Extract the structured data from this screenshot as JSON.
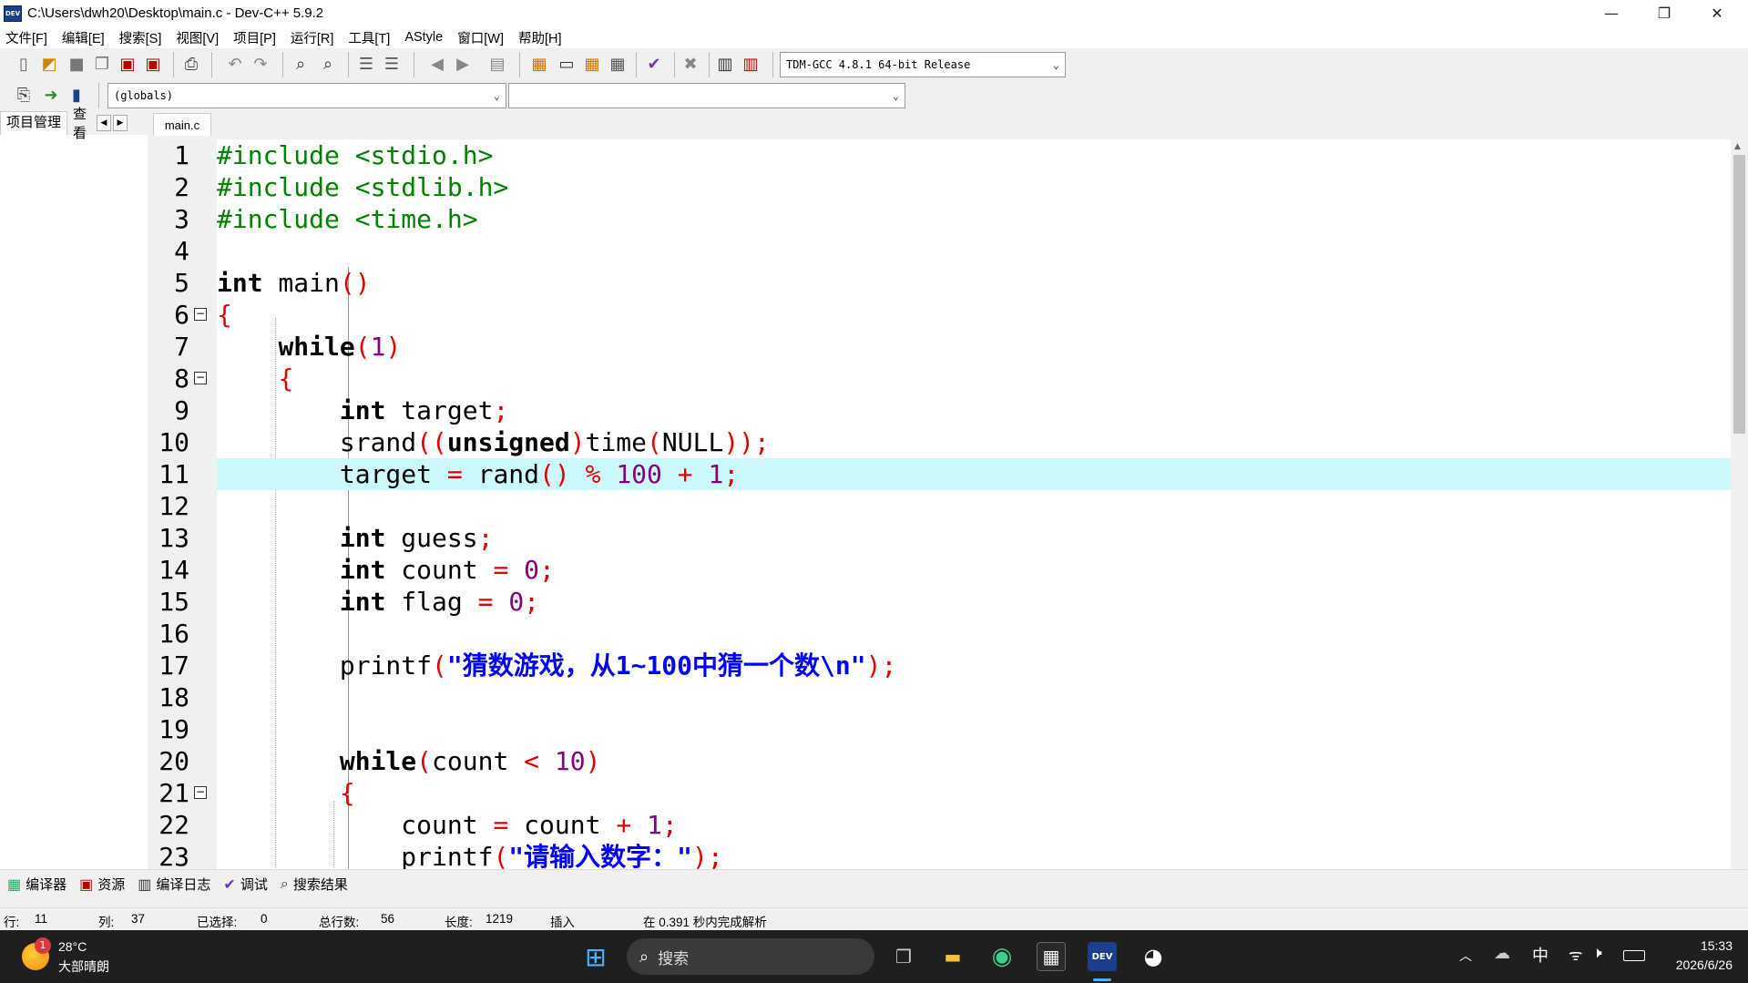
{
  "window": {
    "title": "C:\\Users\\dwh20\\Desktop\\main.c - Dev-C++ 5.9.2",
    "icon_label": "DEV",
    "minimize": "—",
    "maximize": "❐",
    "close": "✕"
  },
  "menu": [
    "文件[F]",
    "编辑[E]",
    "搜索[S]",
    "视图[V]",
    "项目[P]",
    "运行[R]",
    "工具[T]",
    "AStyle",
    "窗口[W]",
    "帮助[H]"
  ],
  "toolbar": {
    "compiler_select": "TDM-GCC 4.8.1 64-bit Release",
    "scope_select": "(globals)",
    "member_select": ""
  },
  "left_panel": {
    "tab_project": "项目管理",
    "tab_view": "查看"
  },
  "editor": {
    "file_tab": "main.c",
    "highlight_line": 11
  },
  "bottom_tabs": [
    "编译器",
    "资源",
    "编译日志",
    "调试",
    "搜索结果"
  ],
  "status": {
    "row_label": "行:",
    "row_value": "11",
    "col_label": "列:",
    "col_value": "37",
    "sel_label": "已选择:",
    "sel_value": "0",
    "lines_label": "总行数:",
    "lines_value": "56",
    "len_label": "长度:",
    "len_value": "1219",
    "mode": "插入",
    "parse": "在 0.391 秒内完成解析"
  },
  "taskbar": {
    "weather_temp": "28°C",
    "weather_desc": "大部晴朗",
    "weather_badge": "1",
    "search_placeholder": "搜索",
    "ime": "中",
    "time": "15:33",
    "date": "2026/6/26"
  }
}
